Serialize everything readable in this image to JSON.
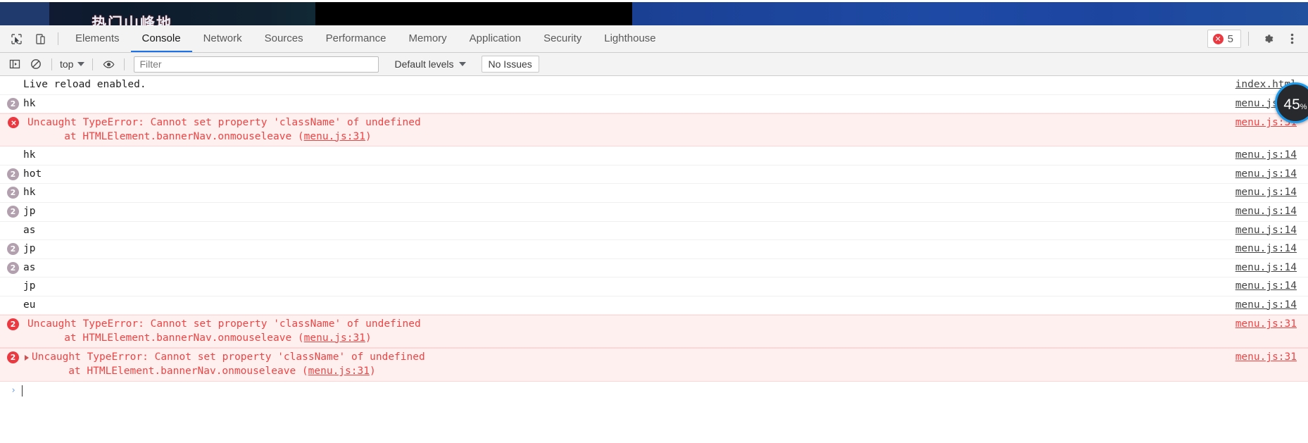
{
  "page_strip": {
    "banner_title": "热门山峰地"
  },
  "tabbar": {
    "inspect_icon": "inspect-cursor-icon",
    "device_icon": "device-toolbar-icon",
    "tabs": [
      {
        "label": "Elements",
        "active": false
      },
      {
        "label": "Console",
        "active": true
      },
      {
        "label": "Network",
        "active": false
      },
      {
        "label": "Sources",
        "active": false
      },
      {
        "label": "Performance",
        "active": false
      },
      {
        "label": "Memory",
        "active": false
      },
      {
        "label": "Application",
        "active": false
      },
      {
        "label": "Security",
        "active": false
      },
      {
        "label": "Lighthouse",
        "active": false
      }
    ],
    "error_count": "5",
    "settings_icon": "gear-icon",
    "more_icon": "kebab-menu-icon"
  },
  "filterbar": {
    "sidebar_icon": "console-sidebar-icon",
    "clear_icon": "clear-console-icon",
    "context": "top",
    "eye_icon": "live-expression-eye-icon",
    "filter_placeholder": "Filter",
    "filter_value": "",
    "levels": "Default levels",
    "issues": "No Issues"
  },
  "console": {
    "rows": [
      {
        "kind": "log",
        "count": "",
        "text": "Live reload enabled.",
        "source": "index.html"
      },
      {
        "kind": "log",
        "count": "2",
        "text": "hk",
        "source": "menu.js:14"
      },
      {
        "kind": "error",
        "count": "",
        "icon": "error-circle-icon",
        "disclose": false,
        "text": "Uncaught TypeError: Cannot set property 'className' of undefined",
        "text2": "at HTMLElement.bannerNav.onmouseleave (",
        "inline_link": "menu.js:31",
        "text3": ")",
        "source": "menu.js:31"
      },
      {
        "kind": "log",
        "count": "",
        "text": "hk",
        "source": "menu.js:14"
      },
      {
        "kind": "log",
        "count": "2",
        "text": "hot",
        "source": "menu.js:14"
      },
      {
        "kind": "log",
        "count": "2",
        "text": "hk",
        "source": "menu.js:14"
      },
      {
        "kind": "log",
        "count": "2",
        "text": "jp",
        "source": "menu.js:14"
      },
      {
        "kind": "log",
        "count": "",
        "text": "as",
        "source": "menu.js:14"
      },
      {
        "kind": "log",
        "count": "2",
        "text": "jp",
        "source": "menu.js:14"
      },
      {
        "kind": "log",
        "count": "2",
        "text": "as",
        "source": "menu.js:14"
      },
      {
        "kind": "log",
        "count": "",
        "text": "jp",
        "source": "menu.js:14"
      },
      {
        "kind": "log",
        "count": "",
        "text": "eu",
        "source": "menu.js:14"
      },
      {
        "kind": "error",
        "count": "2",
        "disclose": false,
        "text": "Uncaught TypeError: Cannot set property 'className' of undefined",
        "text2": "at HTMLElement.bannerNav.onmouseleave (",
        "inline_link": "menu.js:31",
        "text3": ")",
        "source": "menu.js:31"
      },
      {
        "kind": "error",
        "count": "2",
        "disclose": true,
        "text": "Uncaught TypeError: Cannot set property 'className' of undefined",
        "text2": "at HTMLElement.bannerNav.onmouseleave (",
        "inline_link": "menu.js:31",
        "text3": ")",
        "source": "menu.js:31"
      }
    ],
    "prompt_arrow": "›",
    "prompt_value": ""
  },
  "zoom_indicator": {
    "value": "45",
    "unit": "%"
  },
  "colors": {
    "accent": "#1a73e8",
    "error_red": "#eb3941",
    "error_text": "#ef4444",
    "error_bg": "#fff0f0",
    "count_badge": "#b3a0ae",
    "toolbar_bg": "#f3f3f3",
    "zoom_ring": "#1a9bf0"
  }
}
